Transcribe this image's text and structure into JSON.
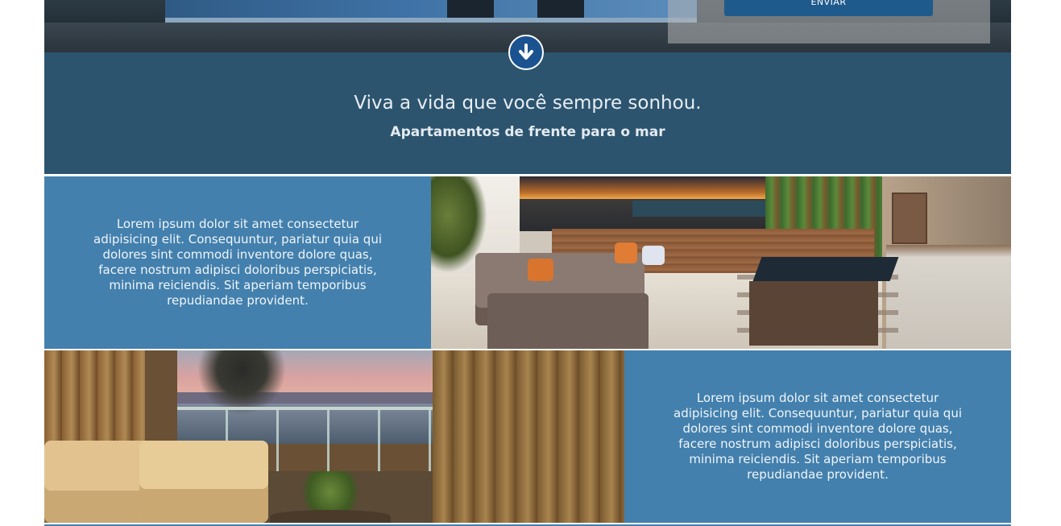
{
  "hero": {
    "submit_label": "ENVIAR"
  },
  "banner": {
    "headline": "Viva a vida que você sempre sonhou.",
    "subheadline": "Apartamentos de frente para o mar",
    "scroll_icon": "arrow-down-circle-icon"
  },
  "features": [
    {
      "text": "Lorem ipsum dolor sit amet consectetur adipisicing elit. Consequuntur, pariatur quia qui dolores sint commodi inventore dolore quas, facere nostrum adipisci doloribus perspiciatis, minima reiciendis. Sit aperiam temporibus repudiandae provident."
    },
    {
      "text": "Lorem ipsum dolor sit amet consectetur adipisicing elit. Consequuntur, pariatur quia qui dolores sint commodi inventore dolore quas, facere nostrum adipisci doloribus perspiciatis, minima reiciendis. Sit aperiam temporibus repudiandae provident."
    }
  ],
  "colors": {
    "banner_bg": "#2c546f",
    "feature_bg": "#4380ad",
    "button_bg": "#1f5a8c",
    "scroll_button_bg": "#1b5290"
  }
}
